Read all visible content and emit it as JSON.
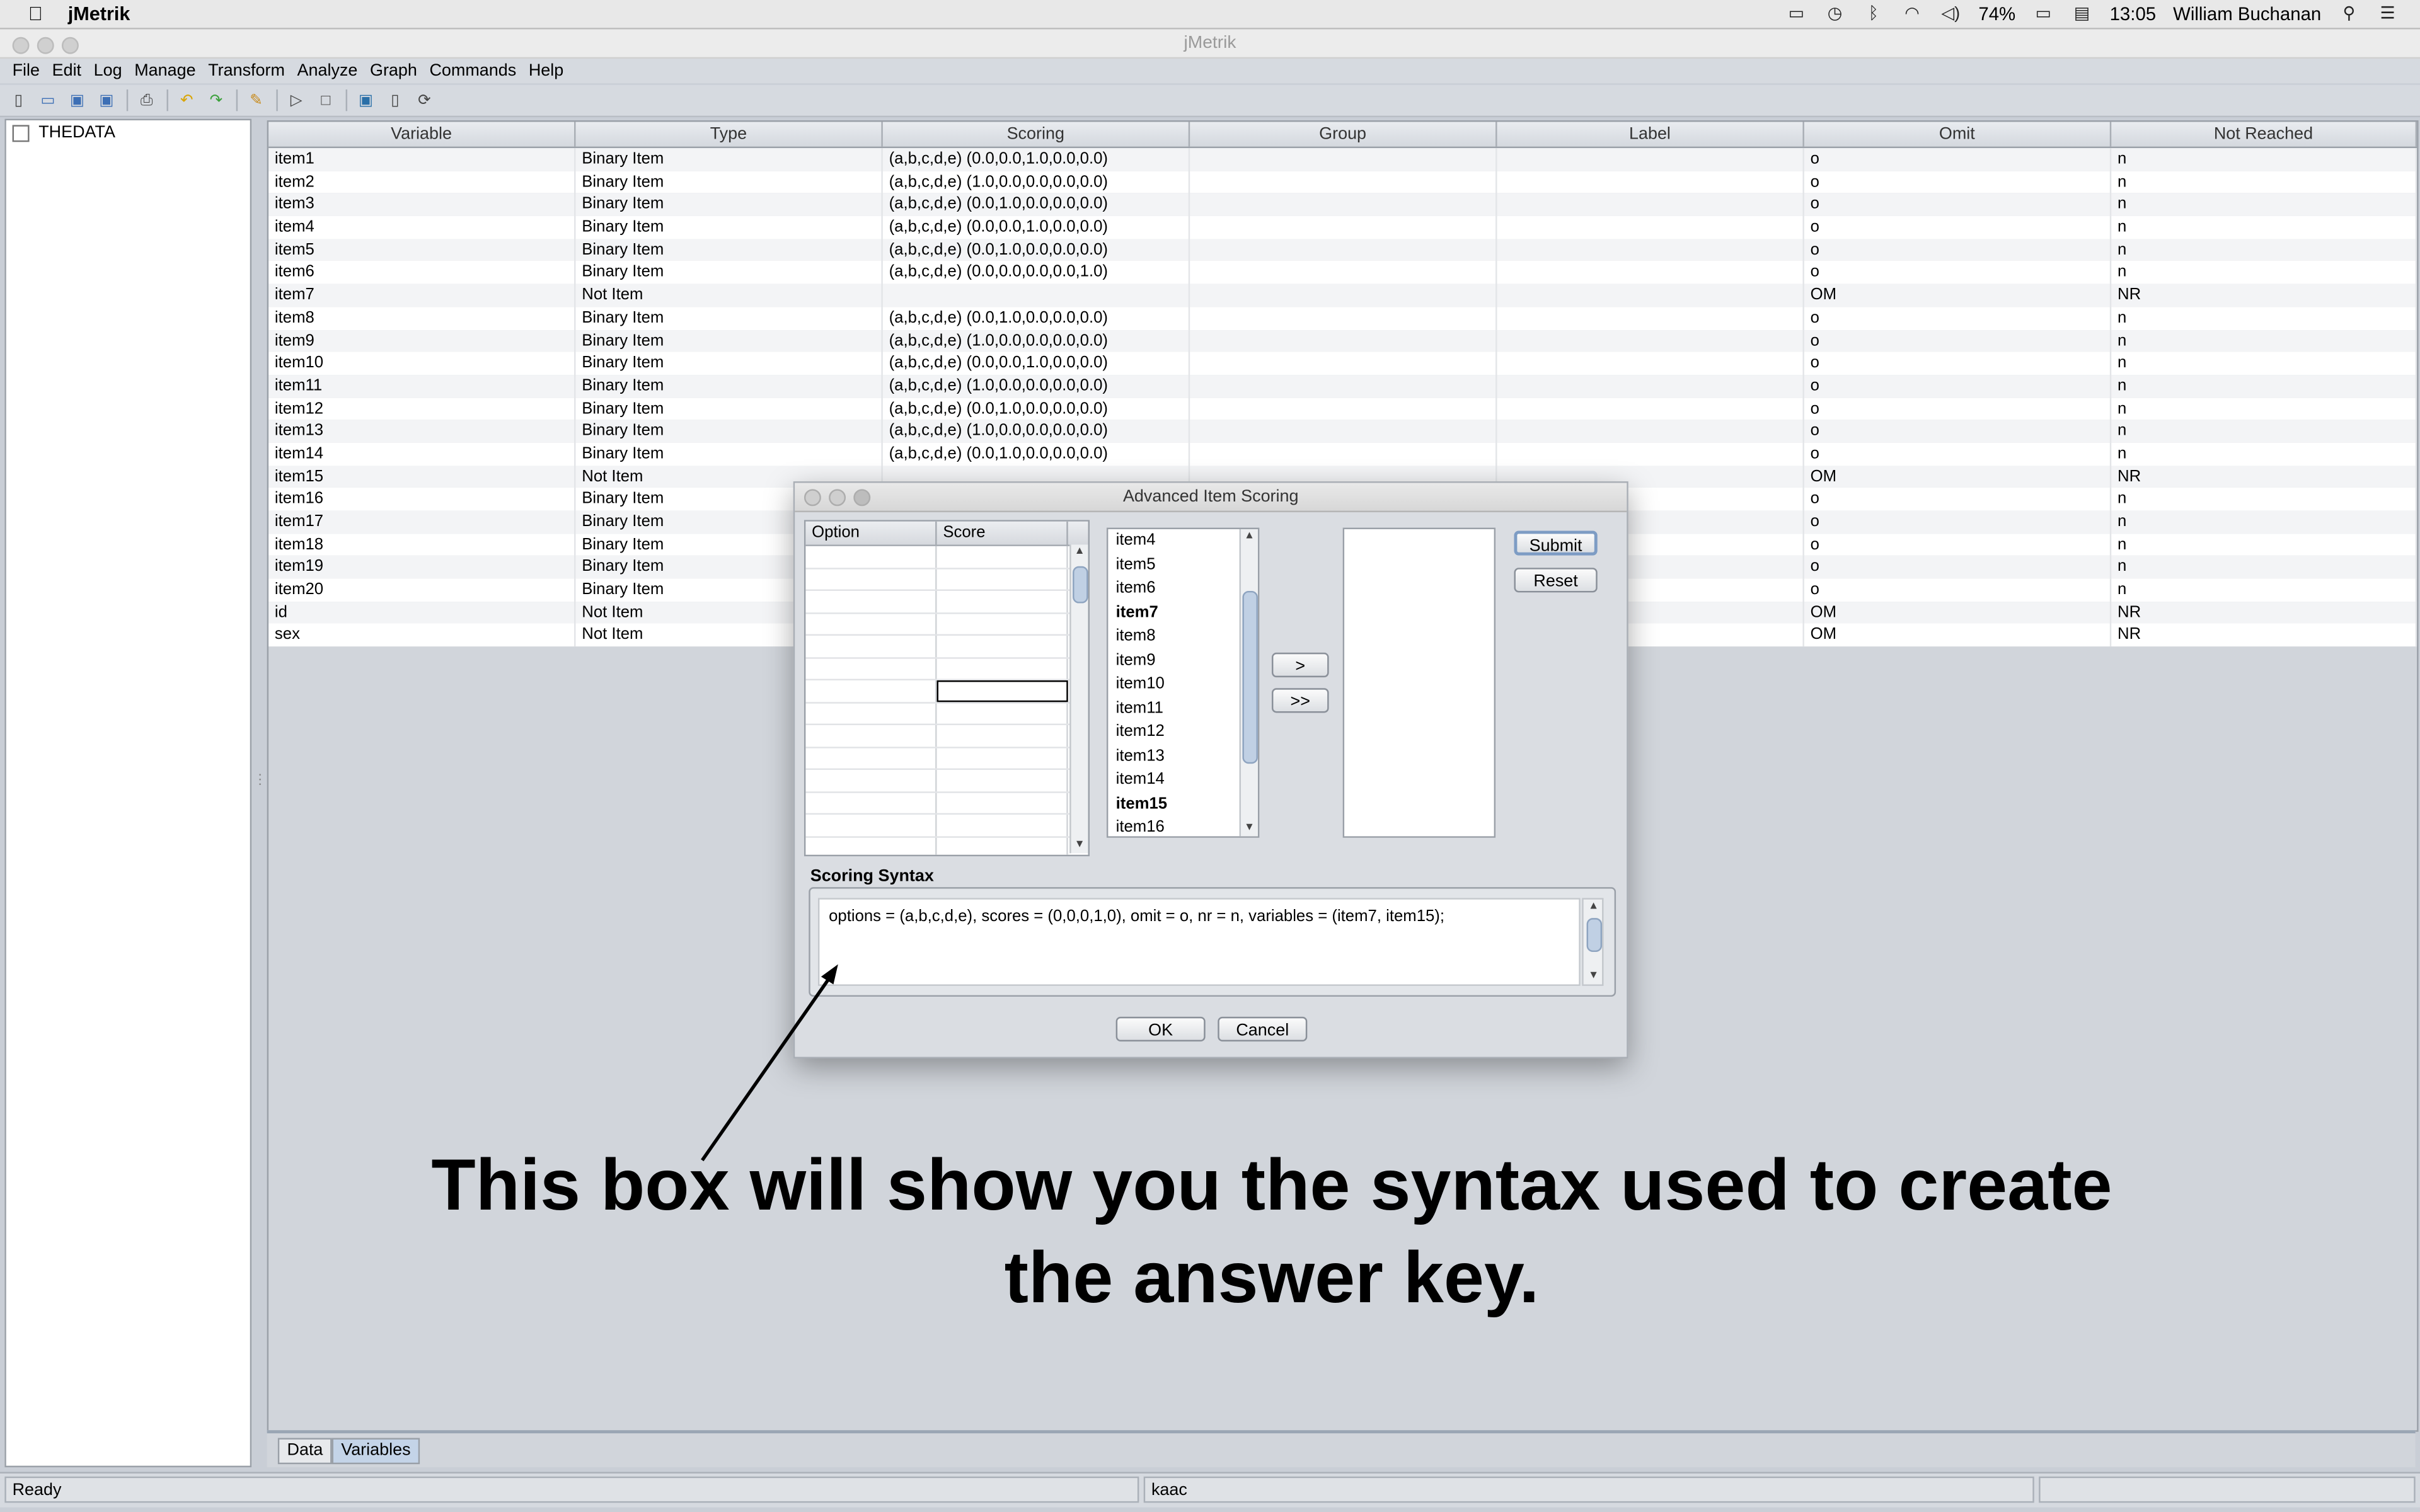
{
  "mac_menubar": {
    "app_name": "jMetrik",
    "battery": "74%",
    "time": "13:05",
    "user": "William Buchanan"
  },
  "window": {
    "title": "jMetrik"
  },
  "menu": [
    "File",
    "Edit",
    "Log",
    "Manage",
    "Transform",
    "Analyze",
    "Graph",
    "Commands",
    "Help"
  ],
  "tree": {
    "root": "THEDATA"
  },
  "table": {
    "columns": [
      "Variable",
      "Type",
      "Scoring",
      "Group",
      "Label",
      "Omit",
      "Not Reached"
    ],
    "rows": [
      [
        "item1",
        "Binary Item",
        "(a,b,c,d,e) (0.0,0.0,1.0,0.0,0.0)",
        "",
        "",
        "o",
        "n"
      ],
      [
        "item2",
        "Binary Item",
        "(a,b,c,d,e) (1.0,0.0,0.0,0.0,0.0)",
        "",
        "",
        "o",
        "n"
      ],
      [
        "item3",
        "Binary Item",
        "(a,b,c,d,e) (0.0,1.0,0.0,0.0,0.0)",
        "",
        "",
        "o",
        "n"
      ],
      [
        "item4",
        "Binary Item",
        "(a,b,c,d,e) (0.0,0.0,1.0,0.0,0.0)",
        "",
        "",
        "o",
        "n"
      ],
      [
        "item5",
        "Binary Item",
        "(a,b,c,d,e) (0.0,1.0,0.0,0.0,0.0)",
        "",
        "",
        "o",
        "n"
      ],
      [
        "item6",
        "Binary Item",
        "(a,b,c,d,e) (0.0,0.0,0.0,0.0,1.0)",
        "",
        "",
        "o",
        "n"
      ],
      [
        "item7",
        "Not Item",
        "",
        "",
        "",
        "OM",
        "NR"
      ],
      [
        "item8",
        "Binary Item",
        "(a,b,c,d,e) (0.0,1.0,0.0,0.0,0.0)",
        "",
        "",
        "o",
        "n"
      ],
      [
        "item9",
        "Binary Item",
        "(a,b,c,d,e) (1.0,0.0,0.0,0.0,0.0)",
        "",
        "",
        "o",
        "n"
      ],
      [
        "item10",
        "Binary Item",
        "(a,b,c,d,e) (0.0,0.0,1.0,0.0,0.0)",
        "",
        "",
        "o",
        "n"
      ],
      [
        "item11",
        "Binary Item",
        "(a,b,c,d,e) (1.0,0.0,0.0,0.0,0.0)",
        "",
        "",
        "o",
        "n"
      ],
      [
        "item12",
        "Binary Item",
        "(a,b,c,d,e) (0.0,1.0,0.0,0.0,0.0)",
        "",
        "",
        "o",
        "n"
      ],
      [
        "item13",
        "Binary Item",
        "(a,b,c,d,e) (1.0,0.0,0.0,0.0,0.0)",
        "",
        "",
        "o",
        "n"
      ],
      [
        "item14",
        "Binary Item",
        "(a,b,c,d,e) (0.0,1.0,0.0,0.0,0.0)",
        "",
        "",
        "o",
        "n"
      ],
      [
        "item15",
        "Not Item",
        "",
        "",
        "",
        "OM",
        "NR"
      ],
      [
        "item16",
        "Binary Item",
        "",
        "",
        "",
        "o",
        "n"
      ],
      [
        "item17",
        "Binary Item",
        "",
        "",
        "",
        "o",
        "n"
      ],
      [
        "item18",
        "Binary Item",
        "",
        "",
        "",
        "o",
        "n"
      ],
      [
        "item19",
        "Binary Item",
        "",
        "",
        "",
        "o",
        "n"
      ],
      [
        "item20",
        "Binary Item",
        "",
        "",
        "",
        "o",
        "n"
      ],
      [
        "id",
        "Not Item",
        "",
        "",
        "",
        "OM",
        "NR"
      ],
      [
        "sex",
        "Not Item",
        "",
        "",
        "",
        "OM",
        "NR"
      ]
    ]
  },
  "tabs": [
    "Data",
    "Variables"
  ],
  "status": {
    "left": "Ready",
    "middle": "kaac"
  },
  "dialog": {
    "title": "Advanced Item Scoring",
    "option_header": "Option",
    "score_header": "Score",
    "items": [
      {
        "label": "item4",
        "bold": false
      },
      {
        "label": "item5",
        "bold": false
      },
      {
        "label": "item6",
        "bold": false
      },
      {
        "label": "item7",
        "bold": true
      },
      {
        "label": "item8",
        "bold": false
      },
      {
        "label": "item9",
        "bold": false
      },
      {
        "label": "item10",
        "bold": false
      },
      {
        "label": "item11",
        "bold": false
      },
      {
        "label": "item12",
        "bold": false
      },
      {
        "label": "item13",
        "bold": false
      },
      {
        "label": "item14",
        "bold": false
      },
      {
        "label": "item15",
        "bold": true
      },
      {
        "label": "item16",
        "bold": false
      }
    ],
    "move_one": ">",
    "move_all": ">>",
    "submit": "Submit",
    "reset": "Reset",
    "syntax_label": "Scoring Syntax",
    "syntax": "options = (a,b,c,d,e), scores = (0,0,0,1,0), omit = o, nr = n, variables = (item7, item15);",
    "ok": "OK",
    "cancel": "Cancel"
  },
  "annotation": {
    "line1": "This box will show you the syntax used to create",
    "line2": "the answer key."
  }
}
